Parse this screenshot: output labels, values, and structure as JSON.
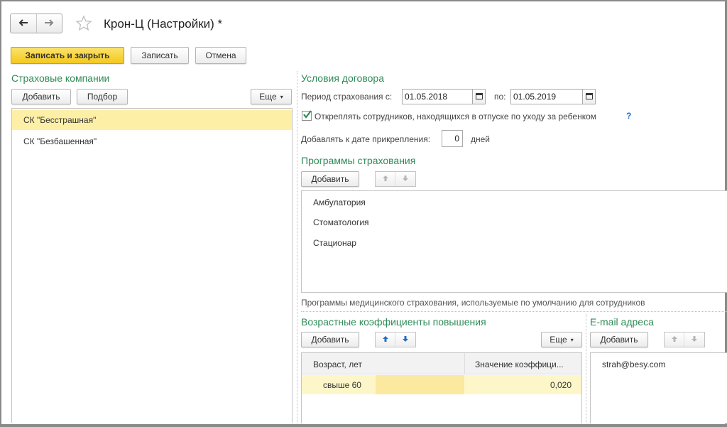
{
  "header": {
    "title": "Крон-Ц (Настройки) *"
  },
  "toolbar": {
    "save_close": "Записать и закрыть",
    "save": "Записать",
    "cancel": "Отмена"
  },
  "insurers": {
    "title": "Страховые компании",
    "add": "Добавить",
    "pick": "Подбор",
    "more": "Еще",
    "items": [
      {
        "label": "СК \"Бесстрашная\"",
        "selected": true
      },
      {
        "label": "СК \"Безбашенная\"",
        "selected": false
      }
    ]
  },
  "contract": {
    "title": "Условия договора",
    "period_label": "Период страхования с:",
    "date_from": "01.05.2018",
    "to_label": "по:",
    "date_to": "01.05.2019",
    "detach_label": "Откреплять сотрудников, находящихся в отпуске по уходу за ребенком",
    "detach_checked": true,
    "help": "?",
    "add_days_label": "Добавлять к дате прикрепления:",
    "days_value": "0",
    "days_unit": "дней"
  },
  "programs": {
    "title": "Программы страхования",
    "add": "Добавить",
    "items": [
      "Амбулатория",
      "Стоматология",
      "Стационар"
    ],
    "note": "Программы медицинского страхования, используемые по умолчанию для сотрудников"
  },
  "coefficients": {
    "title": "Возрастные коэффициенты повышения",
    "add": "Добавить",
    "more": "Еще",
    "columns": [
      "Возраст, лет",
      "Значение коэффици..."
    ],
    "rows": [
      {
        "age": "свыше 60",
        "value": "0,020"
      }
    ]
  },
  "emails": {
    "title": "E-mail адреса",
    "add": "Добавить",
    "items": [
      "strah@besy.com"
    ]
  },
  "colors": {
    "accent_green": "#2e8b57",
    "selected_row": "#fdf0a6",
    "primary_button": "#f4c91d",
    "help_blue": "#1f6fc5"
  }
}
